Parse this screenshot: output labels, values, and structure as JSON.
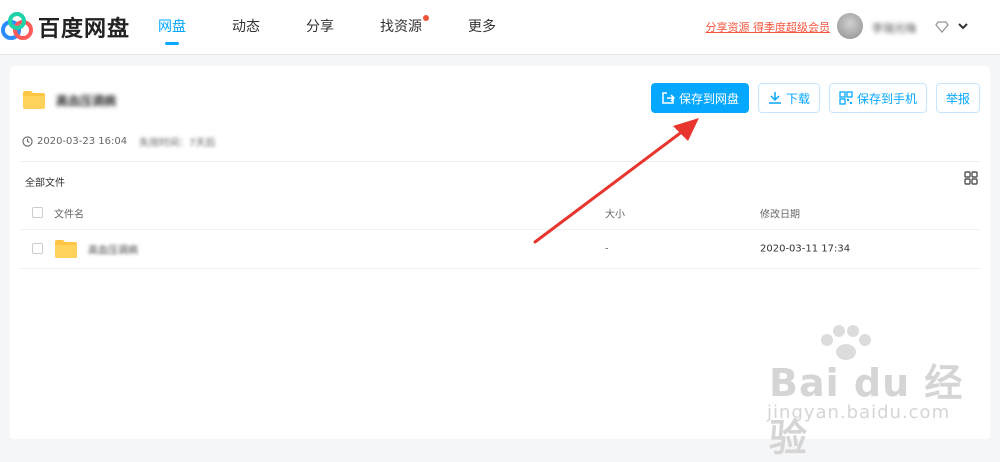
{
  "topbar": {
    "logo_text": "百度网盘",
    "nav": [
      {
        "label": "网盘",
        "active": true
      },
      {
        "label": "动态",
        "active": false
      },
      {
        "label": "分享",
        "active": false
      },
      {
        "label": "找资源",
        "active": false,
        "dot": true
      },
      {
        "label": "更多",
        "active": false
      }
    ],
    "promo": "分享资源 得季度超级会员",
    "username": "李瑞光嗨"
  },
  "share": {
    "name": "高血压调病",
    "created": "2020-03-23 16:04",
    "expiry": "失效时间：7天后"
  },
  "actions": {
    "save": "保存到网盘",
    "download": "下载",
    "save_phone": "保存到手机",
    "report": "举报"
  },
  "breadcrumb": "全部文件",
  "table": {
    "headers": {
      "name": "文件名",
      "size": "大小",
      "date": "修改日期"
    },
    "rows": [
      {
        "name": "高血压调病",
        "size": "-",
        "date": "2020-03-11 17:34"
      }
    ]
  },
  "watermark": {
    "brand": "Bai du 经验",
    "url": "jingyan.baidu.com"
  },
  "colors": {
    "accent": "#06a7ff",
    "annotation": "#e8352e",
    "folder": "#ffc646"
  }
}
